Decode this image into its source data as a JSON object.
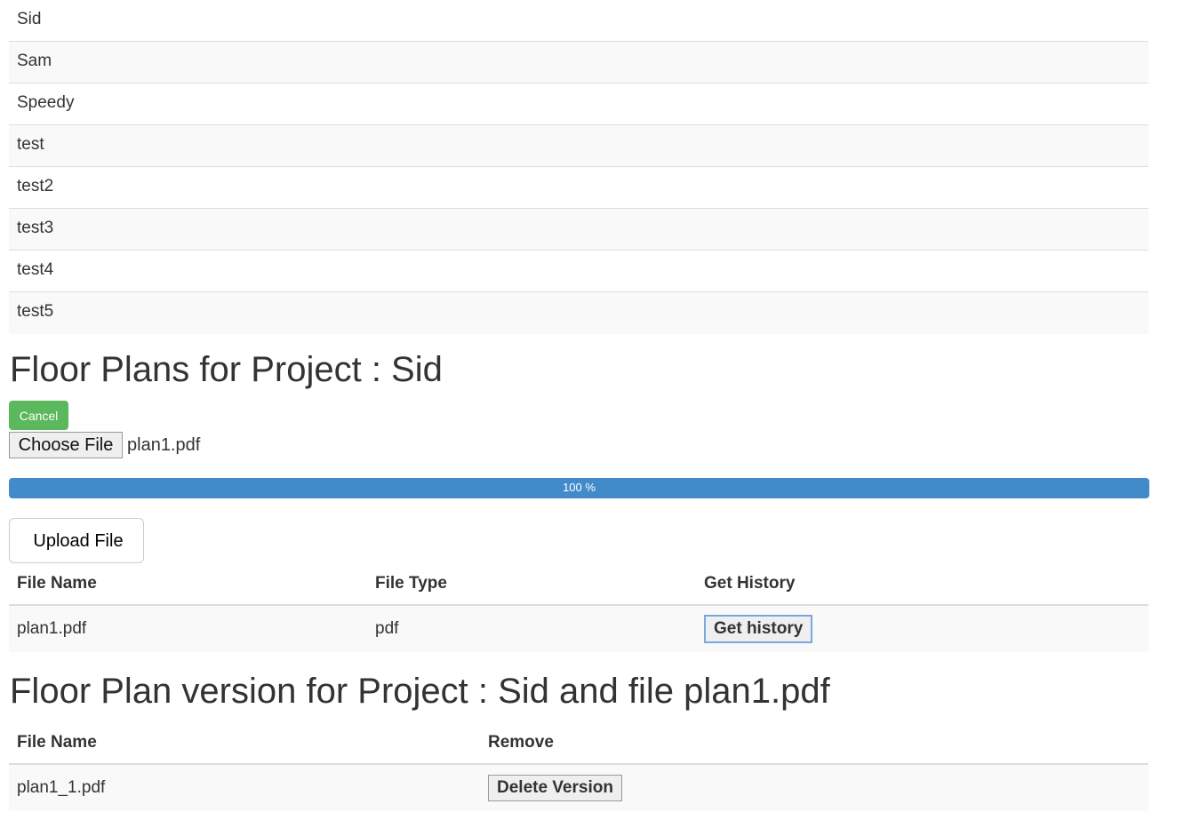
{
  "projects": [
    "Sid",
    "Sam",
    "Speedy",
    "test",
    "test2",
    "test3",
    "test4",
    "test5"
  ],
  "floor_plans": {
    "title": "Floor Plans for Project : Sid",
    "cancel_label": "Cancel",
    "choose_file_label": "Choose File",
    "chosen_file": "plan1.pdf",
    "progress_percent": 100,
    "progress_label": "100 %",
    "upload_label": "Upload File",
    "columns": [
      "File Name",
      "File Type",
      "Get History"
    ],
    "rows": [
      {
        "name": "plan1.pdf",
        "type": "pdf",
        "action": "Get history"
      }
    ]
  },
  "versions": {
    "title": "Floor Plan version for Project : Sid and file plan1.pdf",
    "columns": [
      "File Name",
      "Remove"
    ],
    "rows": [
      {
        "name": "plan1_1.pdf",
        "action": "Delete Version"
      }
    ]
  },
  "colors": {
    "success": "#5cb85c",
    "progress": "#428bca"
  }
}
